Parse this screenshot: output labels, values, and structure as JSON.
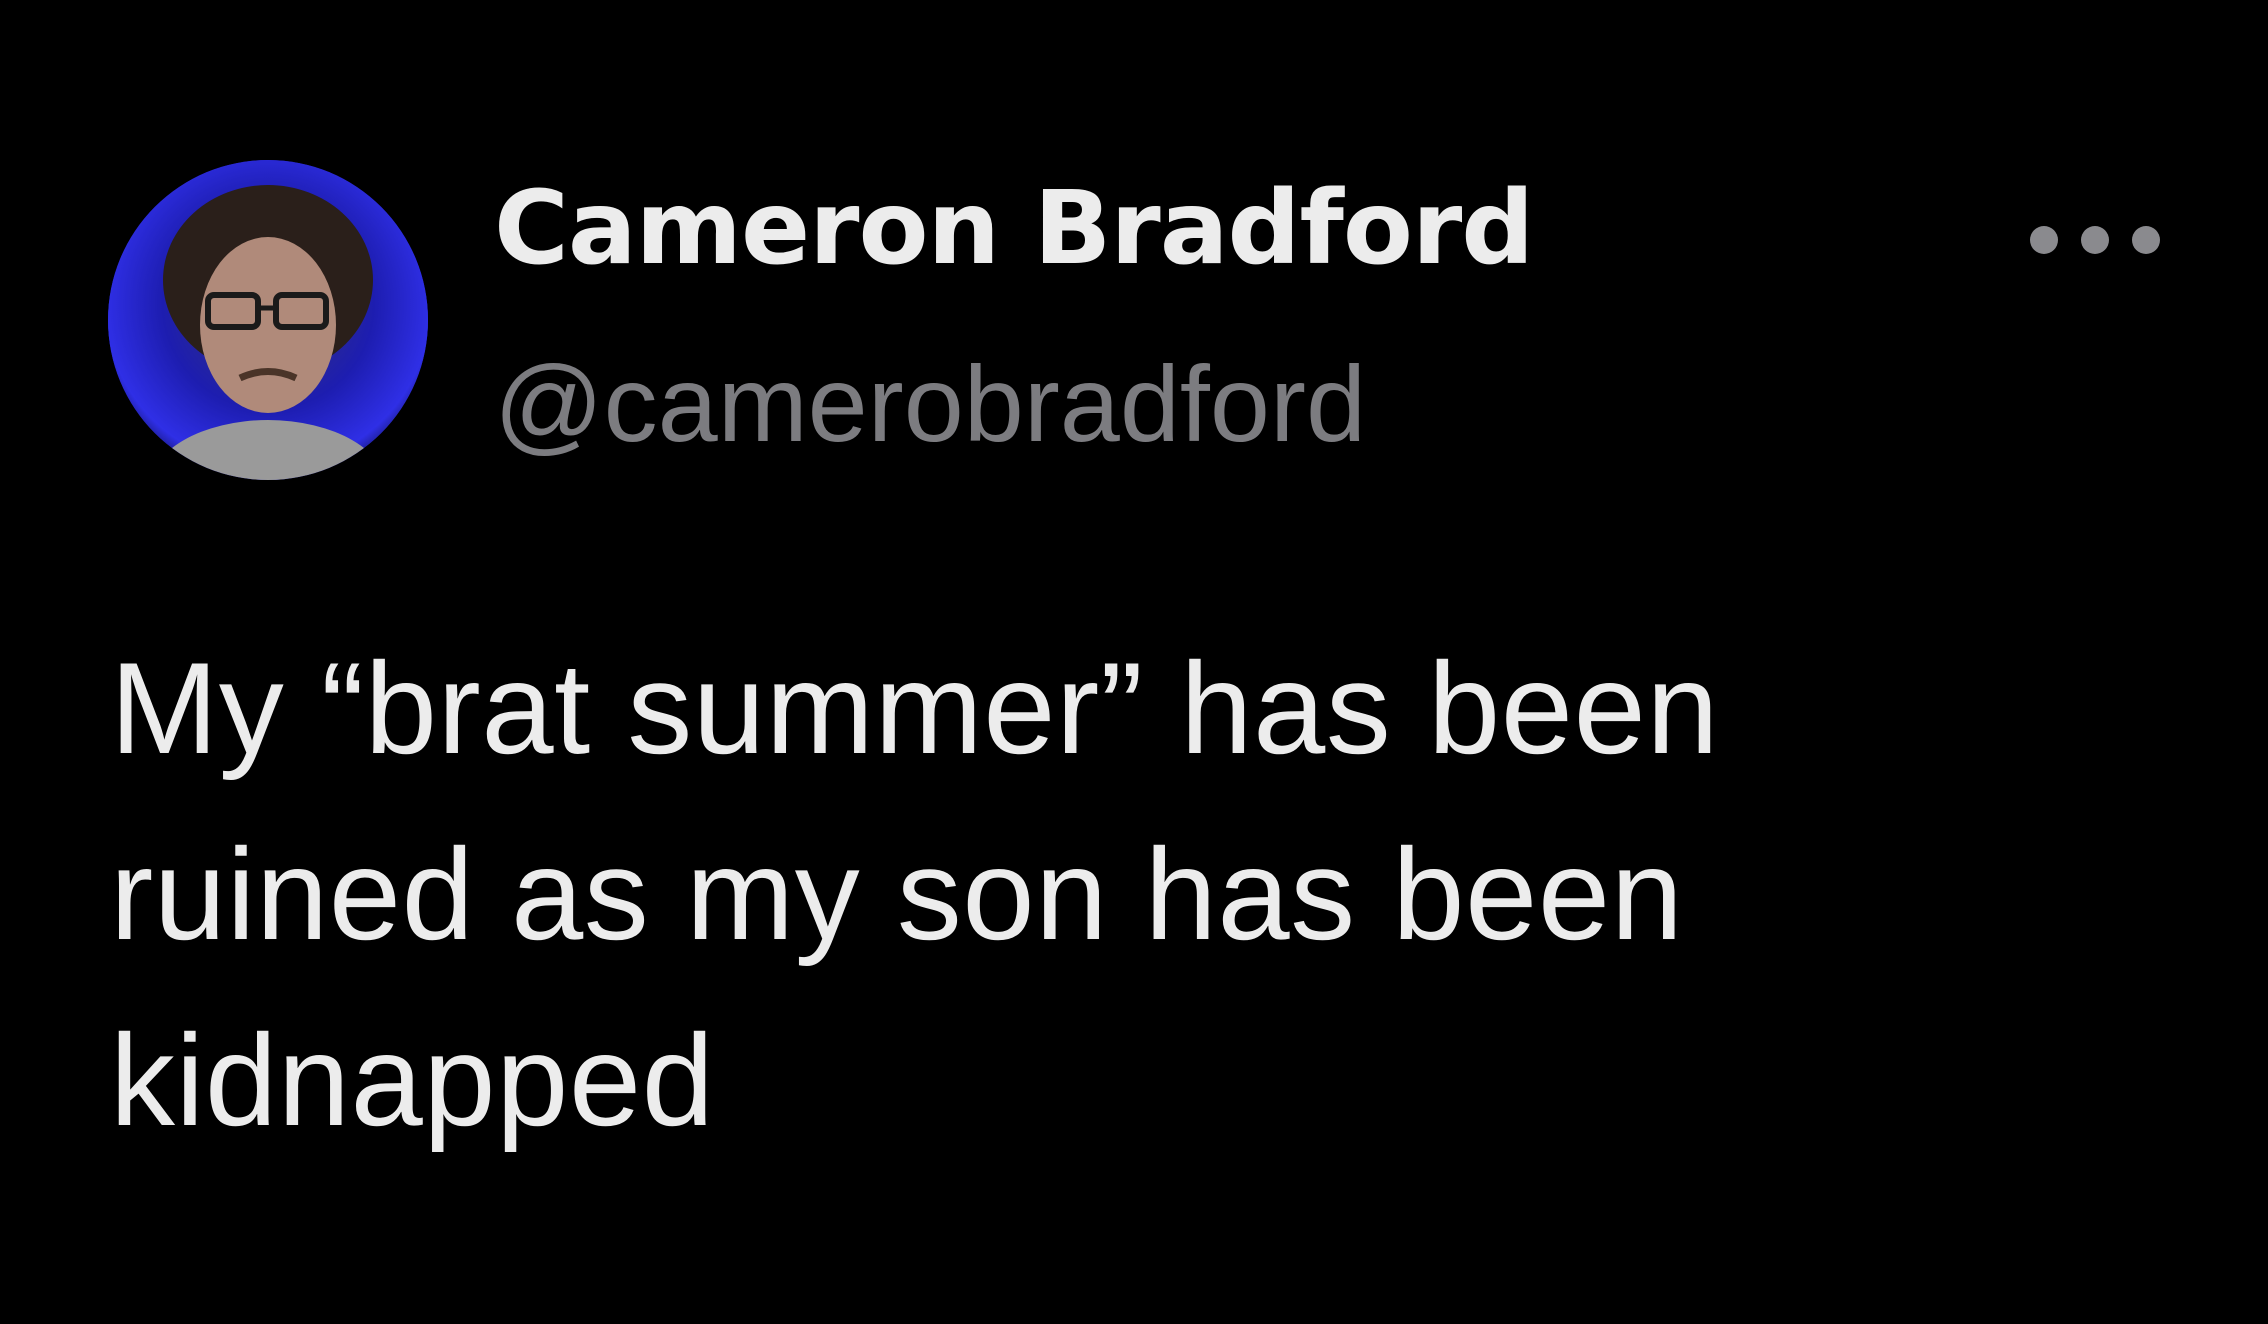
{
  "author": {
    "display_name": "Cameron Bradford",
    "handle": "@camerobradford",
    "avatar_icon": "user-avatar-photo"
  },
  "actions": {
    "more_icon": "more-horizontal-icon"
  },
  "tweet": {
    "text": "My “brat summer” has been\nruined as my son has been\nkidnapped"
  },
  "colors": {
    "background": "#000000",
    "primary_text": "#ececec",
    "secondary_text": "#7c7c80"
  }
}
